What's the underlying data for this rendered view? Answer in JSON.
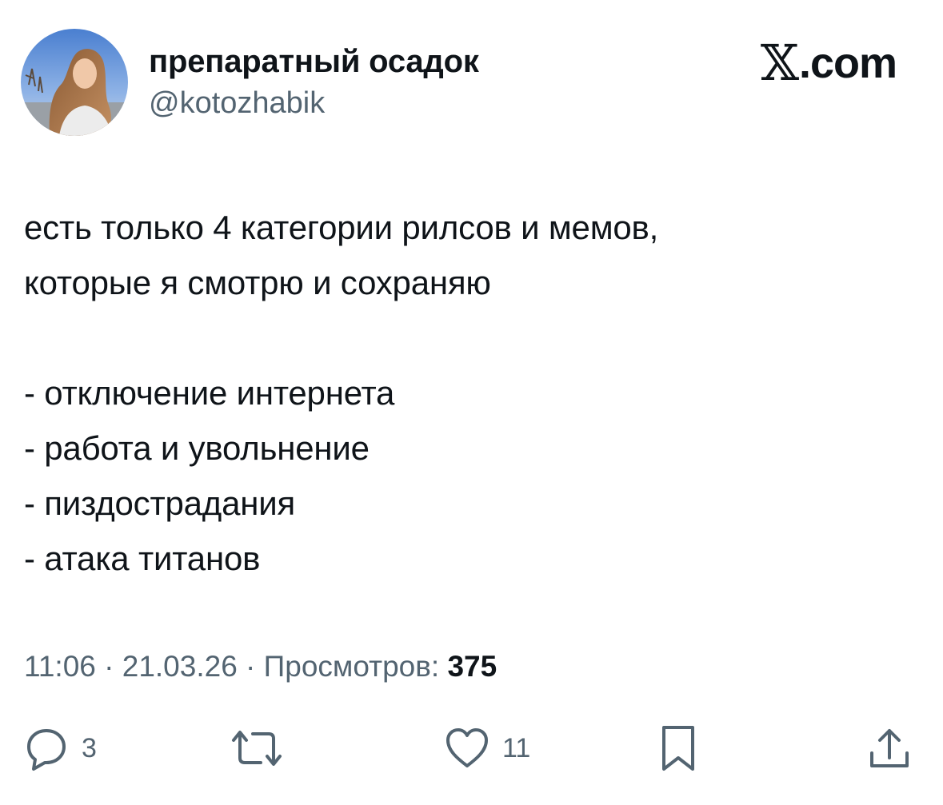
{
  "author": {
    "display_name": "препаратный осадок",
    "handle": "@kotozhabik",
    "avatar": "profile-photo"
  },
  "brand": {
    "mark": "𝕏",
    "suffix": ".com"
  },
  "tweet": {
    "lines": [
      "есть только 4 категории рилсов и мемов,",
      "которые я смотрю и сохраняю",
      "",
      "- отключение интернета",
      "- работа и увольнение",
      "- пиздострадания",
      "- атака титанов"
    ]
  },
  "meta": {
    "time": "11:06",
    "separator": " · ",
    "date": "21.03.26",
    "views_label": "Просмотров:",
    "views_count": "375"
  },
  "actions": {
    "reply": {
      "icon": "reply-icon",
      "count": "3"
    },
    "retweet": {
      "icon": "retweet-icon",
      "count": ""
    },
    "like": {
      "icon": "heart-icon",
      "count": "11"
    },
    "bookmark": {
      "icon": "bookmark-icon",
      "count": ""
    },
    "share": {
      "icon": "share-icon",
      "count": ""
    }
  },
  "colors": {
    "text": "#0f1419",
    "secondary": "#536471",
    "background": "#ffffff"
  }
}
